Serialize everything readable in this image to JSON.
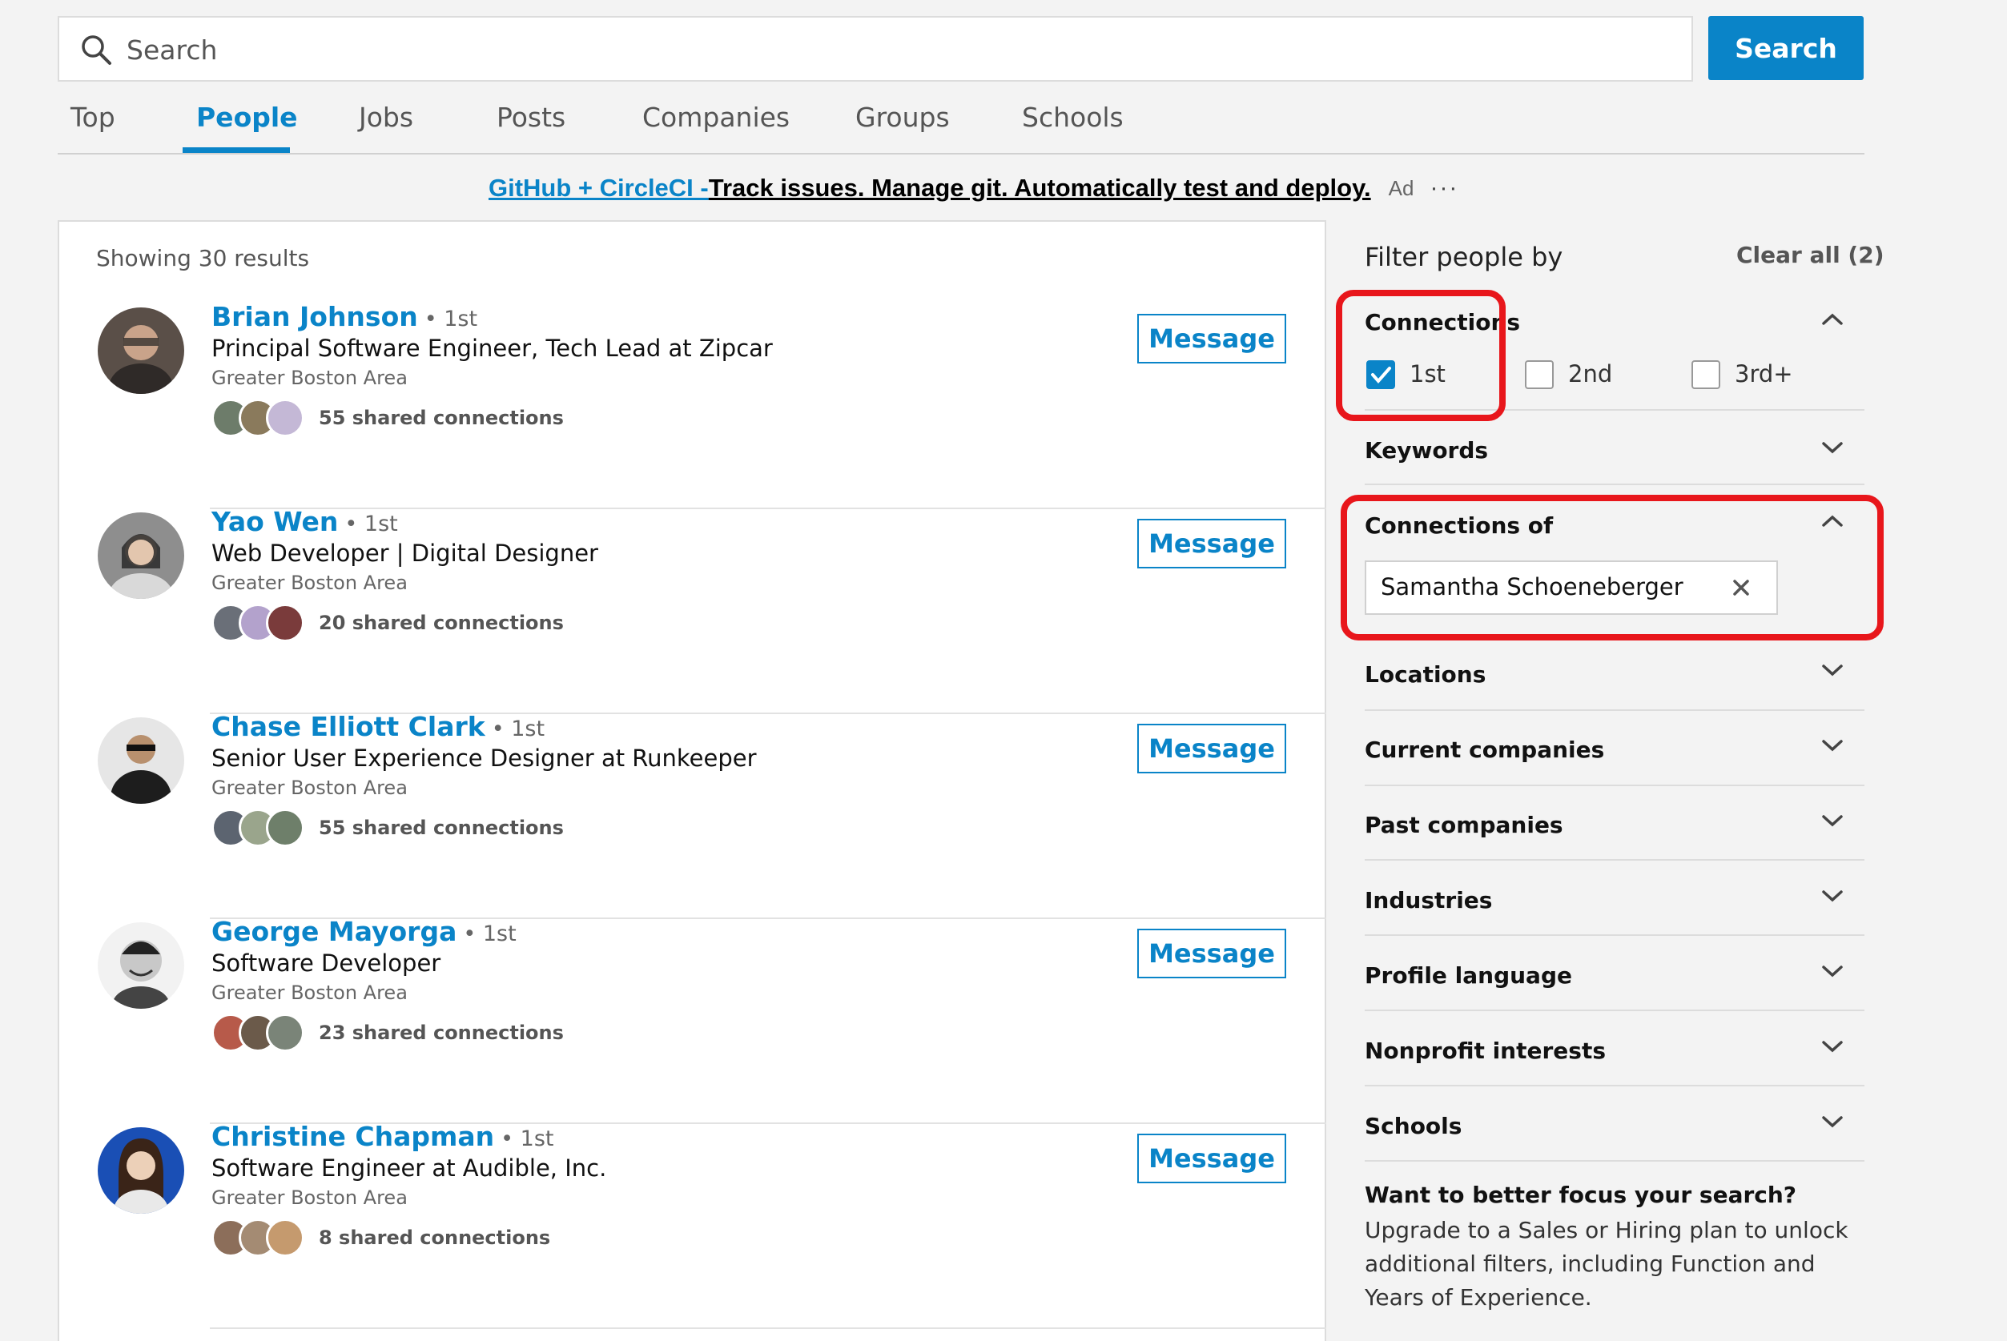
{
  "search": {
    "placeholder": "Search",
    "button_label": "Search"
  },
  "tabs": [
    {
      "label": "Top"
    },
    {
      "label": "People",
      "active": true
    },
    {
      "label": "Jobs"
    },
    {
      "label": "Posts"
    },
    {
      "label": "Companies"
    },
    {
      "label": "Groups"
    },
    {
      "label": "Schools"
    }
  ],
  "ad": {
    "link_text": "GitHub + CircleCI - ",
    "text": "Track issues. Manage git. Automatically test and deploy.",
    "label": "Ad",
    "more": "···"
  },
  "results": {
    "count_text": "Showing 30 results",
    "message_label": "Message",
    "people": [
      {
        "name": "Brian Johnson",
        "degree": "• 1st",
        "headline": "Principal Software Engineer, Tech Lead at Zipcar",
        "location": "Greater Boston Area",
        "shared": "55 shared connections"
      },
      {
        "name": "Yao Wen",
        "degree": "• 1st",
        "headline": "Web Developer | Digital Designer",
        "location": "Greater Boston Area",
        "shared": "20 shared connections"
      },
      {
        "name": "Chase Elliott Clark",
        "degree": "• 1st",
        "headline": "Senior User Experience Designer at Runkeeper",
        "location": "Greater Boston Area",
        "shared": "55 shared connections"
      },
      {
        "name": "George Mayorga",
        "degree": "• 1st",
        "headline": "Software Developer",
        "location": "Greater Boston Area",
        "shared": "23 shared connections"
      },
      {
        "name": "Christine Chapman",
        "degree": "• 1st",
        "headline": "Software Engineer at Audible, Inc.",
        "location": "Greater Boston Area",
        "shared": "8 shared connections"
      }
    ]
  },
  "filters": {
    "title": "Filter people by",
    "clear_all": "Clear all (2)",
    "connections": {
      "title": "Connections",
      "options": [
        {
          "label": "1st",
          "checked": true
        },
        {
          "label": "2nd",
          "checked": false
        },
        {
          "label": "3rd+",
          "checked": false
        }
      ]
    },
    "keywords": "Keywords",
    "connections_of": {
      "title": "Connections of",
      "value": "Samantha Schoeneberger",
      "clear_icon": "×"
    },
    "sections": [
      "Locations",
      "Current companies",
      "Past companies",
      "Industries",
      "Profile language",
      "Nonprofit interests",
      "Schools"
    ],
    "upgrade": {
      "title": "Want to better focus your search?",
      "text": "Upgrade to a Sales or Hiring plan to unlock additional filters, including Function and Years of Experience."
    }
  },
  "colors": {
    "accent": "#0a84c8",
    "highlight": "#e8161b",
    "background": "#f3f3f3"
  }
}
